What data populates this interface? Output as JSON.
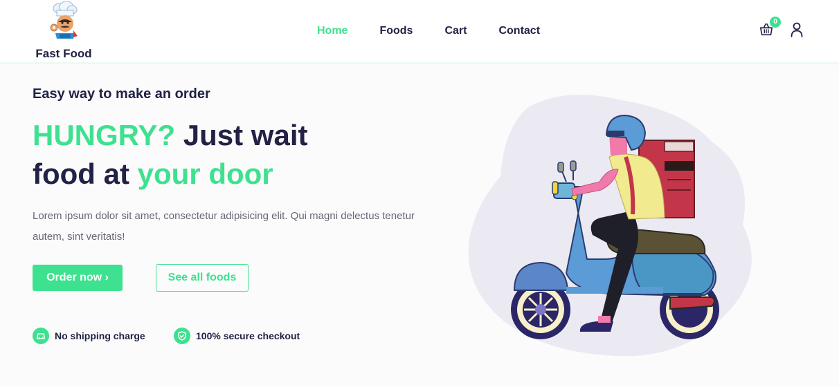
{
  "brand": {
    "name": "Fast Food"
  },
  "nav": {
    "items": [
      {
        "label": "Home",
        "active": true
      },
      {
        "label": "Foods",
        "active": false
      },
      {
        "label": "Cart",
        "active": false
      },
      {
        "label": "Contact",
        "active": false
      }
    ]
  },
  "header": {
    "cart_count": "0",
    "cart_icon": "shopping-basket-icon",
    "user_icon": "user-icon"
  },
  "hero": {
    "subtitle": "Easy way to make an order",
    "title_accent_1": "HUNGRY?",
    "title_plain_1": " Just wait",
    "title_plain_2": "food at ",
    "title_accent_2": "your door",
    "description": "Lorem ipsum dolor sit amet, consectetur adipisicing elit. Qui magni delectus tenetur autem, sint veritatis!",
    "primary_button": "Order now ›",
    "secondary_button": "See all foods"
  },
  "features": [
    {
      "label": "No shipping charge",
      "icon": "car-icon"
    },
    {
      "label": "100% secure checkout",
      "icon": "shield-check-icon"
    }
  ],
  "colors": {
    "accent": "#3ee18f",
    "dark": "#212245",
    "muted": "#666677"
  }
}
